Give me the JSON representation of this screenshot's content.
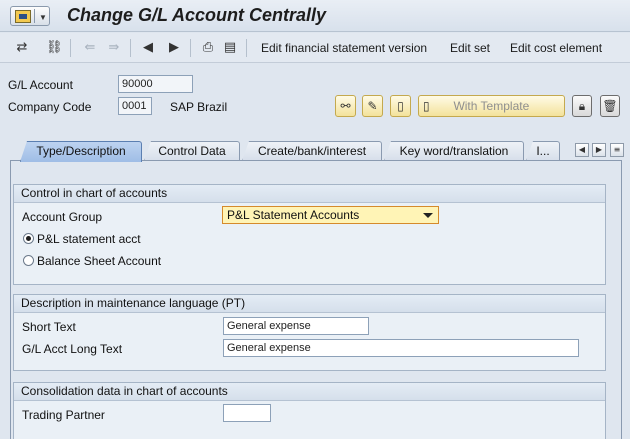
{
  "window": {
    "title": "Change G/L Account Centrally"
  },
  "toolbar": {
    "icons": [
      "display-change-icon",
      "hierarchy-icon",
      "previous-icon",
      "next-icon",
      "first-record-icon",
      "last-record-icon",
      "print-icon",
      "document-icon"
    ],
    "edit_fsv": "Edit financial statement version",
    "edit_set": "Edit set",
    "edit_cost_element": "Edit cost element"
  },
  "header": {
    "gl_account_label": "G/L Account",
    "gl_account_value": "90000",
    "company_code_label": "Company Code",
    "company_code_value": "0001",
    "company_name": "SAP Brazil",
    "with_template": "With Template"
  },
  "tabs": [
    {
      "label": "Type/Description",
      "active": true
    },
    {
      "label": "Control Data",
      "active": false
    },
    {
      "label": "Create/bank/interest",
      "active": false
    },
    {
      "label": "Key word/translation",
      "active": false
    },
    {
      "label": "I...",
      "active": false
    }
  ],
  "control_group": {
    "title": "Control in chart of accounts",
    "account_group_label": "Account Group",
    "account_group_value": "P&L Statement Accounts",
    "radio_pl": "P&L statement acct",
    "radio_bs": "Balance Sheet Account",
    "selected": "P&L statement acct"
  },
  "description_group": {
    "title": "Description in maintenance language (PT)",
    "short_text_label": "Short Text",
    "short_text_value": "General expense",
    "long_text_label": "G/L Acct Long Text",
    "long_text_value": "General expense"
  },
  "consolidation_group": {
    "title": "Consolidation data in chart of accounts",
    "trading_partner_label": "Trading Partner",
    "trading_partner_value": ""
  },
  "colors": {
    "active_tab": "#a9c4ea",
    "required_field": "#fff4b6",
    "background": "#dfe6ef"
  }
}
